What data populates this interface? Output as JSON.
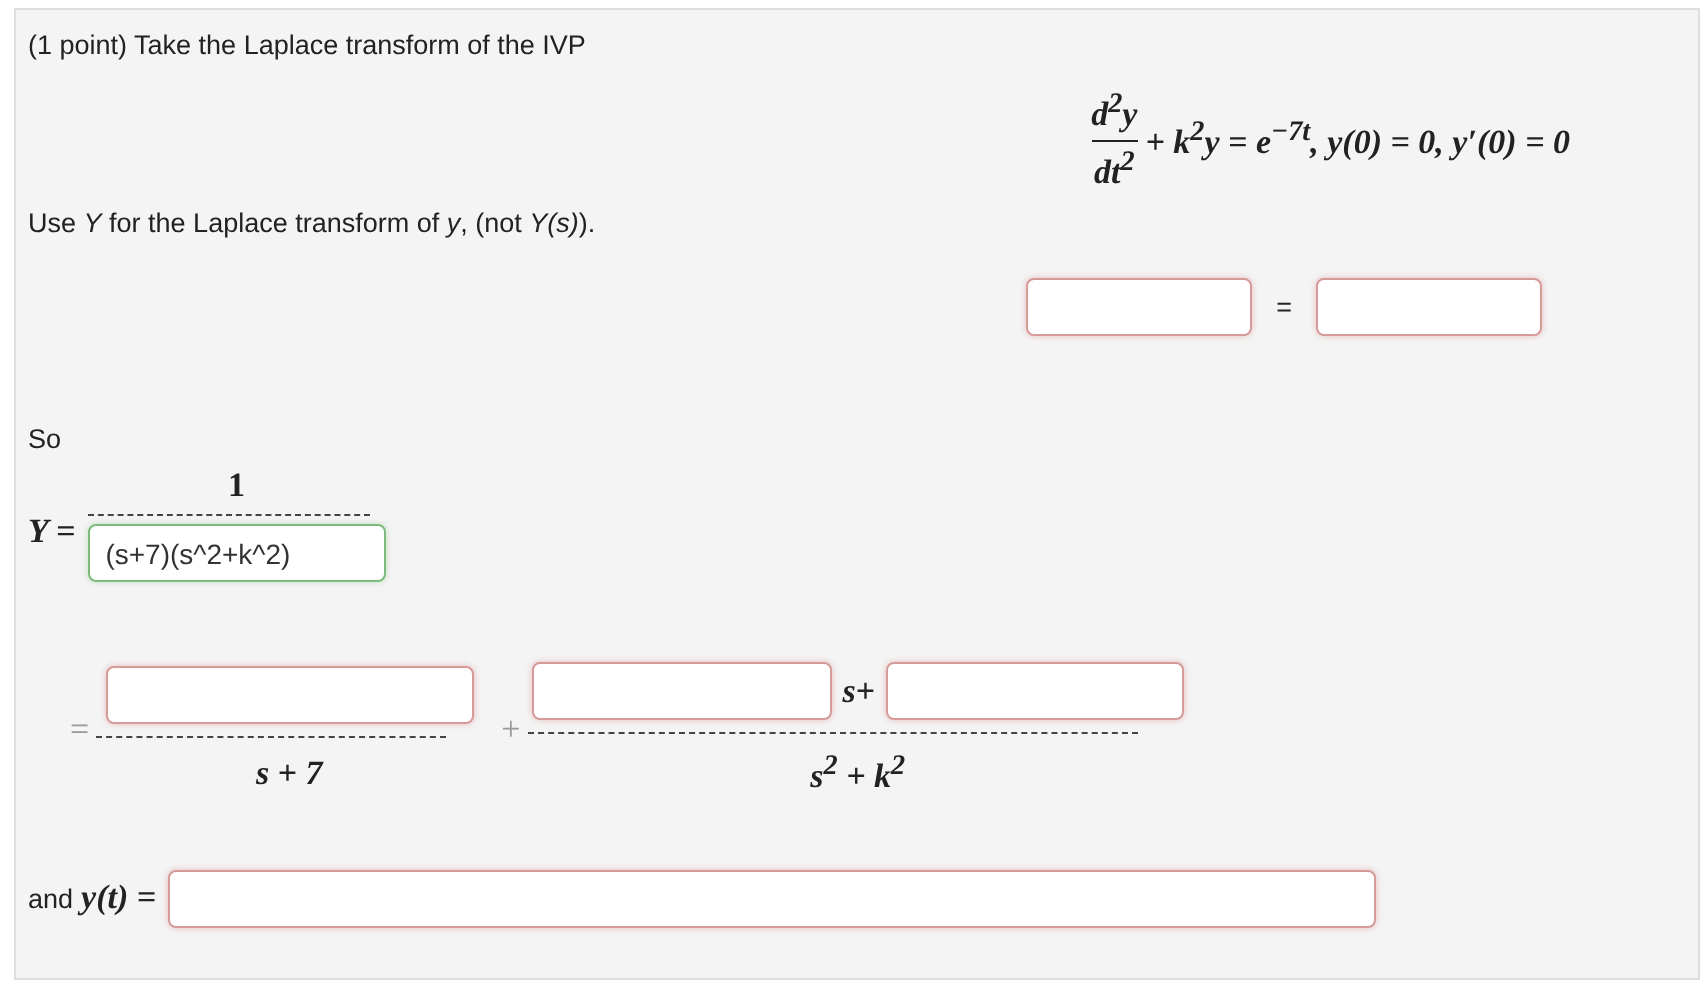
{
  "problem": {
    "intro": "(1 point) Take the Laplace transform of the IVP",
    "equation": {
      "numerator": "d$^{2}$y",
      "denominator": "dt$^{2}$",
      "rest": "+ k$^{2}$y = e$^{−7t}$, y(0) = 0, y′(0) = 0"
    },
    "instruction": "Use *Y* for the Laplace transform of *y*, (not *Y(s)*).",
    "transform_equation": {
      "left": {
        "correct": false
      },
      "separator": "=",
      "right": {
        "correct": false
      }
    },
    "so_label": "So",
    "y_fraction": {
      "lhs": "Y =",
      "numerator": "1",
      "denominator": {
        "value": "(s+7)(s^2+k^2)",
        "correct": true
      }
    },
    "partial_fractions": {
      "equals": "=",
      "term_1": {
        "numerator": {
          "correct": false
        },
        "denominator": "s + 7"
      },
      "plus": "+",
      "term_2": {
        "numerator_a": {
          "correct": false
        },
        "middle": "s+",
        "numerator_b": {
          "correct": false
        },
        "denominator": "s$^{2}$ + k$^{2}$"
      }
    },
    "solution": {
      "label": "and",
      "lhs": "y(t) =",
      "field": {
        "correct": false
      }
    }
  }
}
